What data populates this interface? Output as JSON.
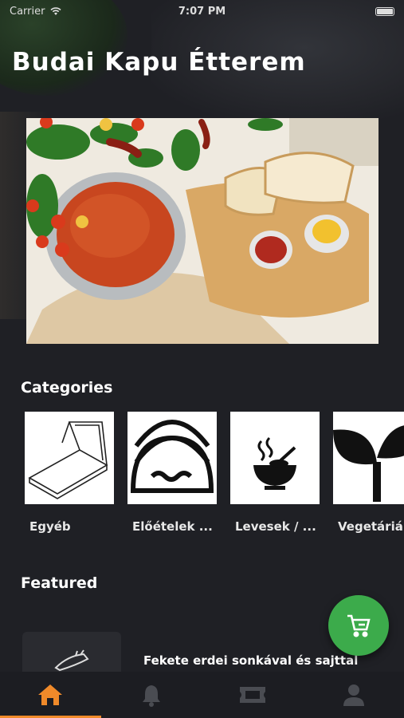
{
  "status_bar": {
    "carrier": "Carrier",
    "time": "7:07 PM"
  },
  "restaurant": {
    "title": "Budai Kapu Étterem"
  },
  "categories": {
    "heading": "Categories",
    "items": [
      {
        "label": "Egyéb",
        "icon": "pizza-box-icon"
      },
      {
        "label": "Előételek ...",
        "icon": "tacos-icon"
      },
      {
        "label": "Levesek / ...",
        "icon": "soup-bowl-icon"
      },
      {
        "label": "Vegetáriá",
        "icon": "sprout-icon"
      }
    ]
  },
  "featured": {
    "heading": "Featured",
    "items": [
      {
        "name": "Fekete erdei sonkával és sajttal"
      }
    ]
  },
  "tabbar": {
    "tabs": [
      {
        "name": "home",
        "icon": "home-icon",
        "active": true
      },
      {
        "name": "notifications",
        "icon": "bell-icon",
        "active": false
      },
      {
        "name": "tickets",
        "icon": "ticket-icon",
        "active": false
      },
      {
        "name": "profile",
        "icon": "user-icon",
        "active": false
      }
    ]
  },
  "colors": {
    "background": "#1f2025",
    "accent": "#f08a2a",
    "cart_button": "#3cab4b"
  }
}
